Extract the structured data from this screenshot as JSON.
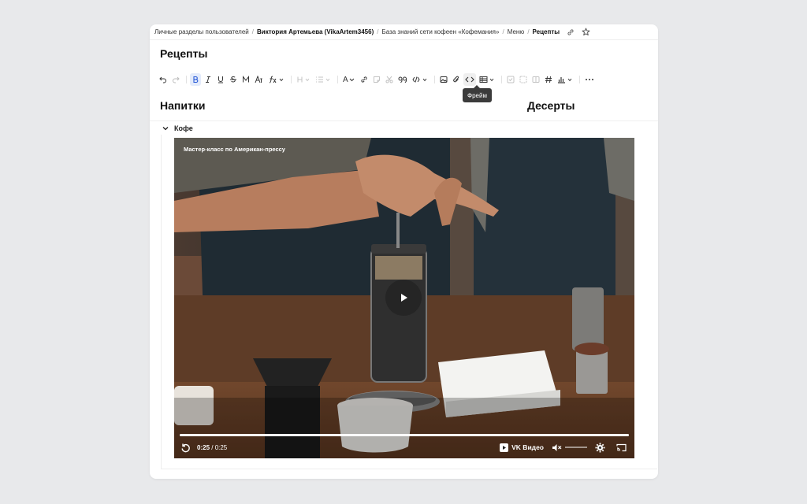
{
  "breadcrumb": {
    "items": [
      "Личные разделы пользователей",
      "Виктория Артемьева (VikaArtem3456)",
      "База знаний сети кофеен «Кофемания»",
      "Меню"
    ],
    "current": "Рецепты",
    "separator": "/"
  },
  "page": {
    "title": "Рецепты"
  },
  "toolbar": {
    "text_color_label": "A",
    "tooltip": "Фрейм"
  },
  "columns": {
    "left": "Напитки",
    "right": "Десерты"
  },
  "section": {
    "coffee_label": "Кофе"
  },
  "video": {
    "title": "Мастер-класс по Американ-прессу",
    "time_current": "0:25",
    "time_total": "0:25",
    "time_separator": " / ",
    "provider": "VK Видео",
    "progress": 1.0,
    "volume": 0.0
  },
  "colors": {
    "accent": "#2a5bd7",
    "active_bg": "#e3ebfb",
    "tooltip_bg": "#3b3b3b"
  }
}
